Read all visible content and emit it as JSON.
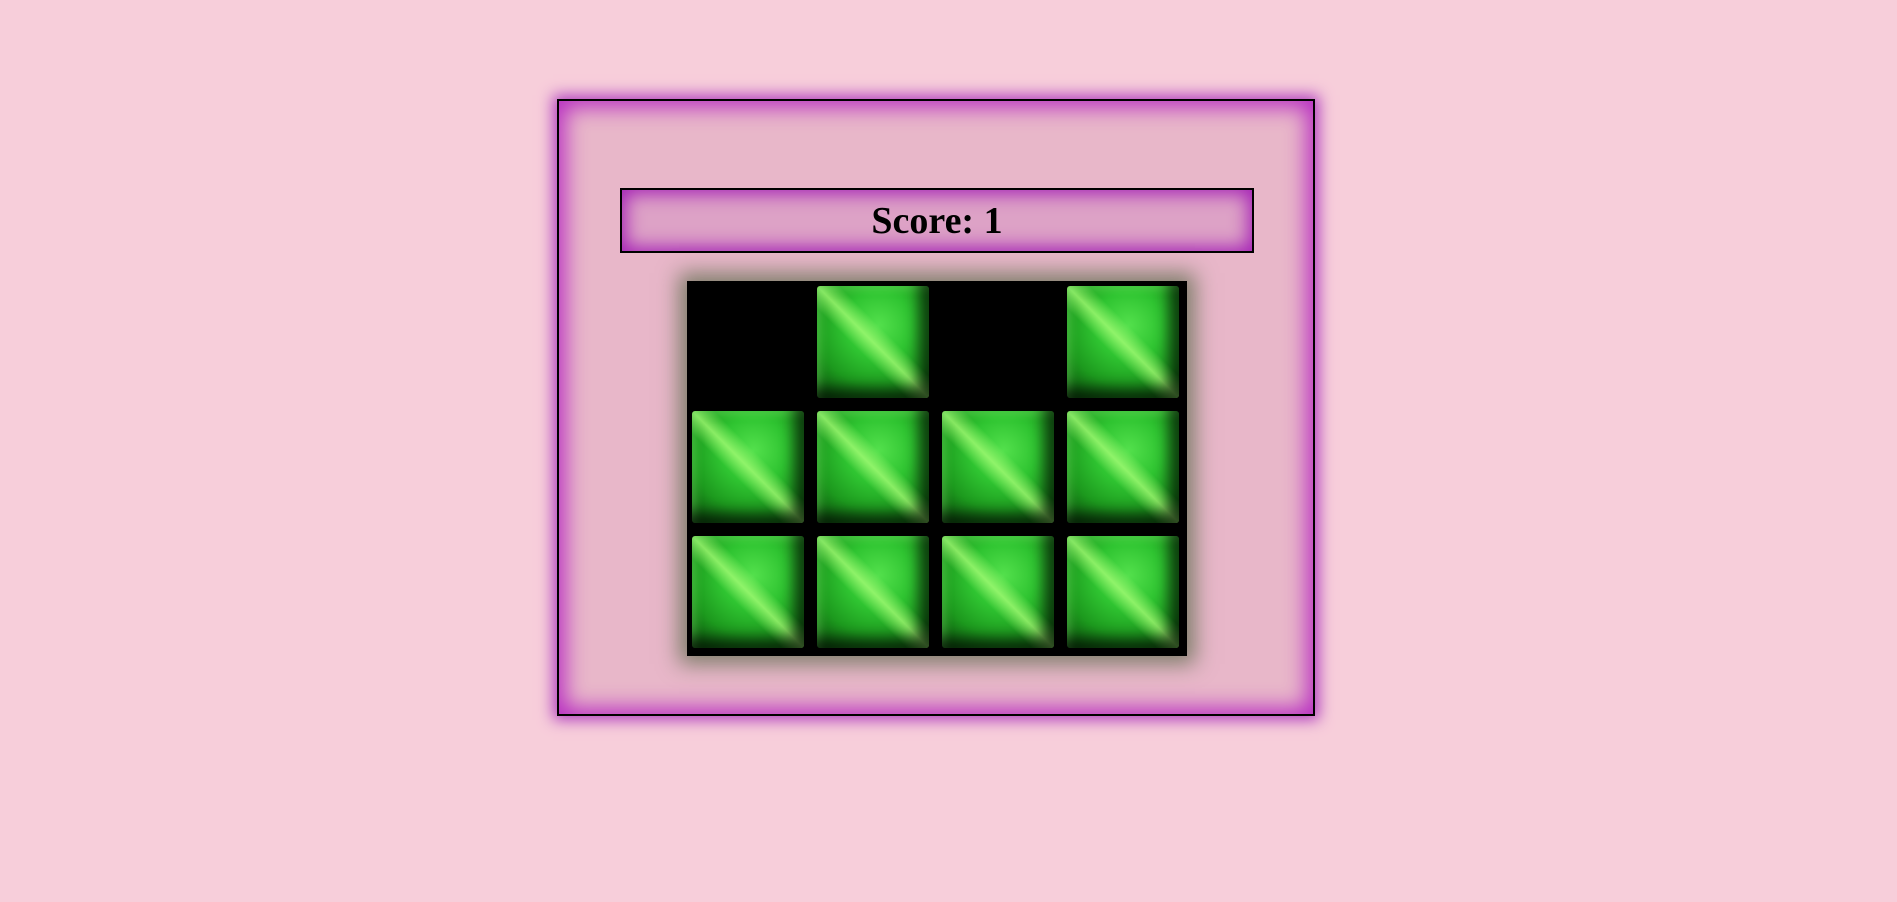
{
  "score": {
    "label": "Score: 1"
  },
  "board": {
    "columns": 4,
    "rows": 3,
    "tiles": [
      "empty",
      "filled",
      "empty",
      "filled",
      "filled",
      "filled",
      "filled",
      "filled",
      "filled",
      "filled",
      "filled",
      "filled"
    ]
  },
  "colors": {
    "page_background": "#f7ceda",
    "panel_glow": "#b82ec2",
    "tile_green": "#2fc431",
    "board_background": "#000000"
  }
}
